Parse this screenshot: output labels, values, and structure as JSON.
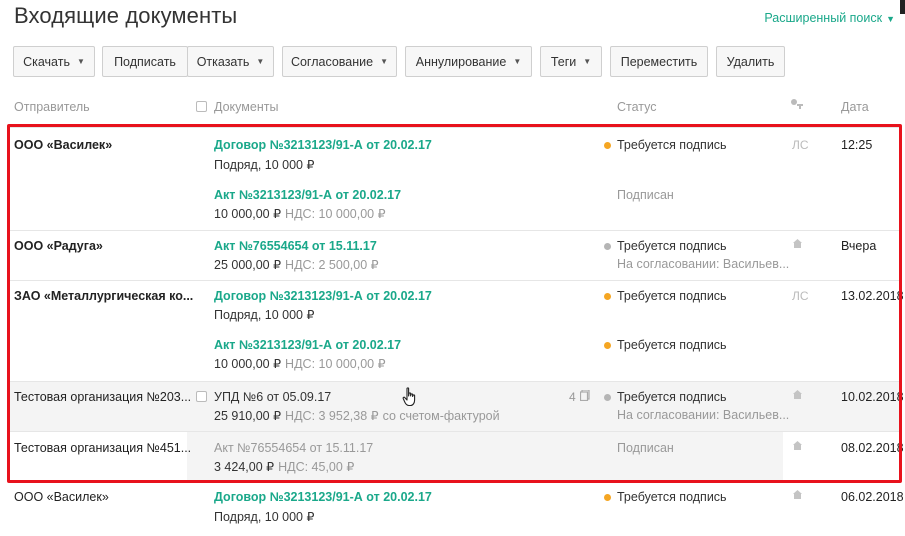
{
  "page": {
    "title": "Входящие документы",
    "advanced_search": "Расширенный поиск"
  },
  "toolbar": {
    "download": "Скачать",
    "sign": "Подписать",
    "reject": "Отказать",
    "approval": "Согласование",
    "annul": "Аннулирование",
    "tags": "Теги",
    "move": "Переместить",
    "delete": "Удалить"
  },
  "columns": {
    "sender": "Отправитель",
    "documents": "Документы",
    "status": "Статус",
    "date": "Дата"
  },
  "rows": [
    {
      "sender": "ООО «Василек»",
      "date": "12:25",
      "signature": "ЛС",
      "docs": [
        {
          "title": "Договор №3213123/91-А от 20.02.17",
          "sub": "Подряд, 10 000 ₽",
          "status": "Требуется подпись",
          "status_color": "#f5a623"
        },
        {
          "title": "Акт №3213123/91-А от 20.02.17",
          "sub": "10 000,00 ₽",
          "vat": "НДС: 10 000,00 ₽",
          "status": "Подписан"
        }
      ]
    },
    {
      "sender": "ООО «Радуга»",
      "date": "Вчера",
      "signature": "building-icon",
      "docs": [
        {
          "title": "Акт №76554654 от 15.11.17",
          "sub": "25 000,00 ₽",
          "vat": "НДС: 2 500,00 ₽",
          "status": "Требуется подпись",
          "status_color": "#b5b5b5",
          "status_sub": "На согласовании: Васильев..."
        }
      ]
    },
    {
      "sender": "ЗАО «Металлургическая ко...",
      "date": "13.02.2018",
      "signature": "ЛС",
      "docs": [
        {
          "title": "Договор №3213123/91-А от 20.02.17",
          "sub": "Подряд, 10 000 ₽",
          "status": "Требуется подпись",
          "status_color": "#f5a623"
        },
        {
          "title": "Акт №3213123/91-А от 20.02.17",
          "sub": "10 000,00 ₽",
          "vat": "НДС: 10 000,00 ₽",
          "status": "Требуется подпись",
          "status_color": "#f5a623"
        }
      ]
    },
    {
      "sender": "Тестовая организация №203...",
      "date": "10.02.2018",
      "signature": "building-icon",
      "docs": [
        {
          "title": "УПД №6 от 05.09.17",
          "sub": "25 910,00 ₽",
          "vat": "НДС: 3 952,38 ₽",
          "extra": "со счетом-фактурой",
          "count": "4",
          "status": "Требуется подпись",
          "status_color": "#b5b5b5",
          "status_sub": "На согласовании: Васильев..."
        }
      ]
    },
    {
      "sender": "Тестовая организация №451...",
      "date": "08.02.2018",
      "signature": "building-icon",
      "docs": [
        {
          "title": "Акт №76554654 от 15.11.17",
          "sub": "3 424,00 ₽",
          "vat": "НДС: 45,00 ₽",
          "status": "Подписан"
        }
      ]
    },
    {
      "sender": "ООО «Василек»",
      "date": "06.02.2018",
      "signature": "building-icon",
      "docs": [
        {
          "title": "Договор №3213123/91-А от 20.02.17",
          "sub": "Подряд, 10 000 ₽",
          "status": "Требуется подпись",
          "status_color": "#f5a623"
        }
      ]
    }
  ]
}
